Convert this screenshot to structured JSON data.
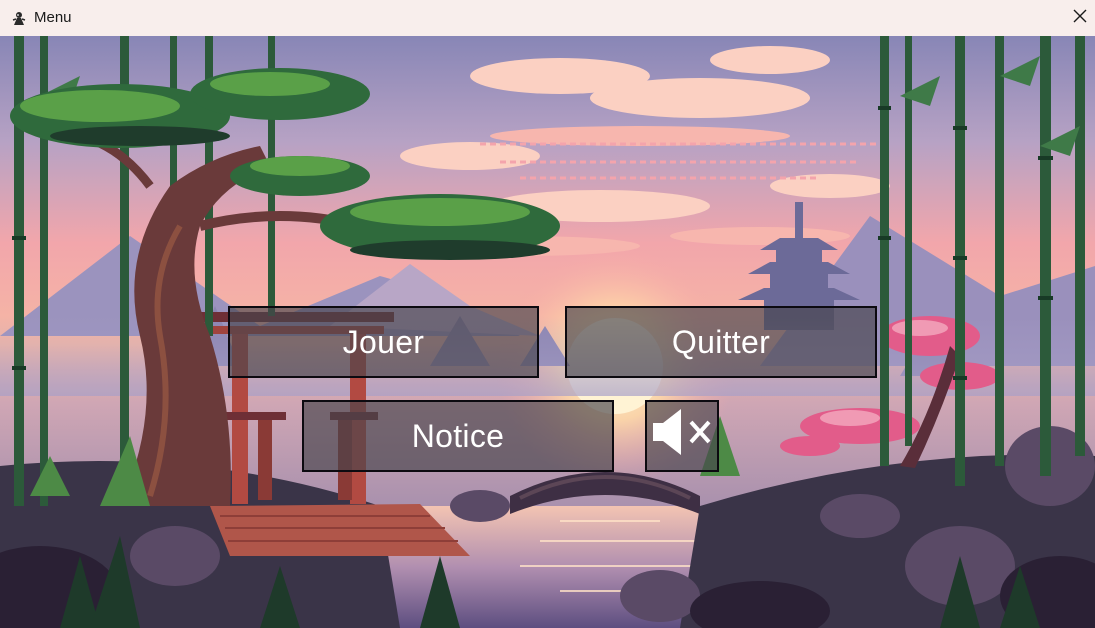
{
  "window": {
    "title": "Menu",
    "app_icon": "game-app-icon",
    "close_icon": "close-icon"
  },
  "menu": {
    "play_label": "Jouer",
    "quit_label": "Quitter",
    "help_label": "Notice",
    "sound_icon": "speaker-muted-icon",
    "sound_muted": true
  },
  "background": {
    "description_icon": "pixel-art-japanese-garden-background",
    "colors": {
      "sky_top": "#8a86b8",
      "sky_pink": "#f0a0a8",
      "sun": "#fff0c8",
      "button_fill": "#48444c",
      "button_border": "#0c0a10"
    }
  }
}
